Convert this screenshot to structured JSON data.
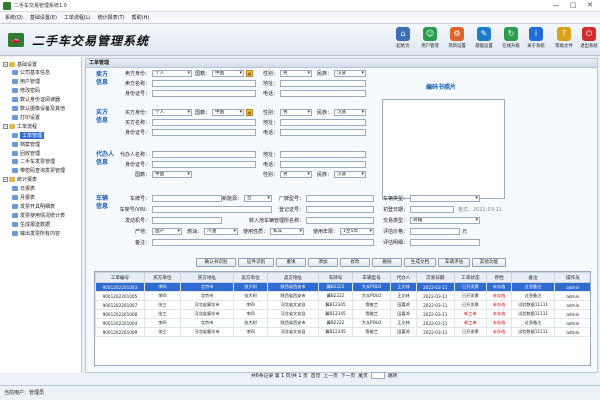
{
  "window": {
    "title": "二手车交易管理系统1.0",
    "minimize": "—",
    "maximize": "□",
    "close": "✕"
  },
  "menu": [
    "系统(Q)",
    "基础设置(E)",
    "工单流程(L)",
    "统计报表(T)",
    "帮助(H)"
  ],
  "banner": {
    "system_name": "二手车交易管理系统"
  },
  "toolbar": [
    {
      "label": "起始页",
      "icon": "home-page-icon",
      "color": "#3b6fb6",
      "glyph": "⌂"
    },
    {
      "label": "用户管理",
      "icon": "user-icon",
      "color": "#2a9d4a",
      "glyph": "☺"
    },
    {
      "label": "项目设置",
      "icon": "project-settings-icon",
      "color": "#e0662b",
      "glyph": "⚙"
    },
    {
      "label": "基础设置",
      "icon": "base-settings-icon",
      "color": "#1f7ac9",
      "glyph": "✎"
    },
    {
      "label": "在线升级",
      "icon": "upgrade-icon",
      "color": "#2d9d4f",
      "glyph": "↻"
    },
    {
      "label": "关于系统",
      "icon": "info-icon",
      "color": "#1e6dd8",
      "glyph": "i"
    },
    {
      "label": "帮助文件",
      "icon": "help-icon",
      "color": "#d9a21b",
      "glyph": "?"
    },
    {
      "label": "退出系统",
      "icon": "exit-icon",
      "color": "#d12b2b",
      "glyph": "⏻"
    }
  ],
  "tree": [
    {
      "label": "基础设置",
      "level": 0
    },
    {
      "label": "公司基本信息",
      "level": 1
    },
    {
      "label": "用户管理",
      "level": 1
    },
    {
      "label": "修改密码",
      "level": 1
    },
    {
      "label": "数认身份证阅读器",
      "level": 1
    },
    {
      "label": "数认摄像设备及其他",
      "level": 1
    },
    {
      "label": "打印设置",
      "level": 1
    },
    {
      "label": "工单流程",
      "level": 0
    },
    {
      "label": "工单管理",
      "level": 1,
      "selected": true
    },
    {
      "label": "档案管理",
      "level": 1
    },
    {
      "label": "回收管理",
      "level": 1
    },
    {
      "label": "二手车发票管理",
      "level": 1
    },
    {
      "label": "带密码查询发票管理",
      "level": 1
    },
    {
      "label": "统计报表",
      "level": 0
    },
    {
      "label": "日报表",
      "level": 1
    },
    {
      "label": "月报表",
      "level": 1
    },
    {
      "label": "发票开具明细表",
      "level": 1
    },
    {
      "label": "发票使用情况统计表",
      "level": 1
    },
    {
      "label": "生成报送数据",
      "level": 1
    },
    {
      "label": "输出发票所有内容",
      "level": 1
    }
  ],
  "panel": {
    "title": "工单管理"
  },
  "sections": {
    "seller": "卖方信息",
    "buyer": "买方信息",
    "agent": "代办人信息",
    "vehicle": "车辆信息",
    "photo": "编码书照片"
  },
  "seller": {
    "identity_label": "卖方身份：",
    "identity": "个人",
    "country_label": "国籍：",
    "country": "中国",
    "gender_label": "性别：",
    "gender": "男",
    "ethnic_label": "民族：",
    "ethnic": "汉族",
    "name_label": "卖方名称：",
    "address_label": "地址：",
    "id_label": "身份证号：",
    "phone_label": "电话："
  },
  "buyer": {
    "identity_label": "买方身份：",
    "identity": "个人",
    "country_label": "国籍：",
    "country": "中国",
    "gender_label": "性别：",
    "gender": "男",
    "ethnic_label": "民族：",
    "ethnic": "汉族",
    "name_label": "买方名称：",
    "address_label": "地址：",
    "id_label": "身份证号：",
    "phone_label": "电话："
  },
  "agent": {
    "name_label": "代办人名称：",
    "address_label": "地址：",
    "id_label": "身份证号：",
    "phone_label": "电话：",
    "country_label": "国籍：",
    "country": "中国",
    "gender_label": "性别：",
    "gender": "男",
    "ethnic_label": "民族：",
    "ethnic": "汉族"
  },
  "vehicle": {
    "plate_label": "车牌号：",
    "new_label": "新能源：",
    "new_value": "否",
    "maker_label": "厂牌型号：",
    "type_label": "车辆类型：",
    "vin_label": "车架号/VIN：",
    "reg_label": "登记证号：",
    "reg_date_label": "初登日期：",
    "reg_date_hint": "格式：2022-03-11",
    "engine_label": "发动机号：",
    "transfer_label": "转入地车辆管理所名称：",
    "deal_label": "交易类型：",
    "deal_value": "转籍",
    "origin_label": "产地：",
    "origin_value": "国产",
    "fuel_label": "燃油：",
    "fuel_value": "汽油",
    "usage_label": "使用性质：",
    "usage_value": "私车",
    "years_label": "使用年限：",
    "years_value": "1至5年",
    "price_label": "评估价格：",
    "price_unit": "元",
    "remark_label": "备注：",
    "assess_label": "评估明细："
  },
  "actions": [
    "确认书识别",
    "证件识别",
    "重填",
    "添加",
    "修改",
    "删除",
    "生成文档",
    "车辆评估",
    "其他功能"
  ],
  "table": {
    "headers": [
      "工单编号",
      "买方单位",
      "买方地址",
      "卖方单位",
      "卖方地址",
      "车牌号",
      "车辆型号",
      "代办人",
      "交易日期",
      "工单状态",
      "存档",
      "备注",
      "操作员"
    ],
    "rows": [
      [
        "9001202201003",
        "李四",
        "北京市",
        "张大树",
        "陕西省西安市",
        "冀B2222",
        "大众POLO",
        "王文林",
        "2022-03-11",
        "已开发票",
        "未存档",
        "过息备注",
        "admin"
      ],
      [
        "9001202201005",
        "李四",
        "北京市",
        "张大树",
        "陕西省西安市",
        "冀B2222",
        "大众POLO",
        "王文林",
        "2022-03-11",
        "已开发票",
        "未存档",
        "过息备注",
        "admin"
      ],
      [
        "9001202201007",
        "张三",
        "河北省廊坊市",
        "李四",
        "河北省文安县",
        "冀B12345",
        "雪佛兰",
        "田嘉鸿",
        "2022-03-11",
        "已开发票",
        "未存档",
        "试验数据11111",
        "admin"
      ],
      [
        "9001202201008",
        "张三",
        "河北省廊坊市",
        "李四",
        "河北省文安县",
        "冀B12345",
        "雪佛兰",
        "田嘉鸿",
        "2022-03-11",
        "新工单",
        "未存档",
        "试验数据11111",
        "admin"
      ],
      [
        "9001202201004",
        "李四",
        "北京市",
        "张大树",
        "陕西省西安市",
        "冀B2222",
        "大众POLO",
        "王文林",
        "2022-03-11",
        "新工单",
        "未存档",
        "过息备注",
        "admin"
      ],
      [
        "9001202201009",
        "张三",
        "河北省廊坊市",
        "李四",
        "河北省文安县",
        "冀B12345",
        "雪佛兰",
        "田嘉鸿",
        "2022-03-11",
        "已开发票",
        "未存档",
        "试验数据11111",
        "admin"
      ]
    ]
  },
  "pager": {
    "summary": "共6条记录 第 1 页/共 1 页",
    "first": "首页",
    "prev": "上一页",
    "next": "下一页",
    "last": "尾页",
    "go": "跳转"
  },
  "status": {
    "text": "当前用户：管理员"
  }
}
